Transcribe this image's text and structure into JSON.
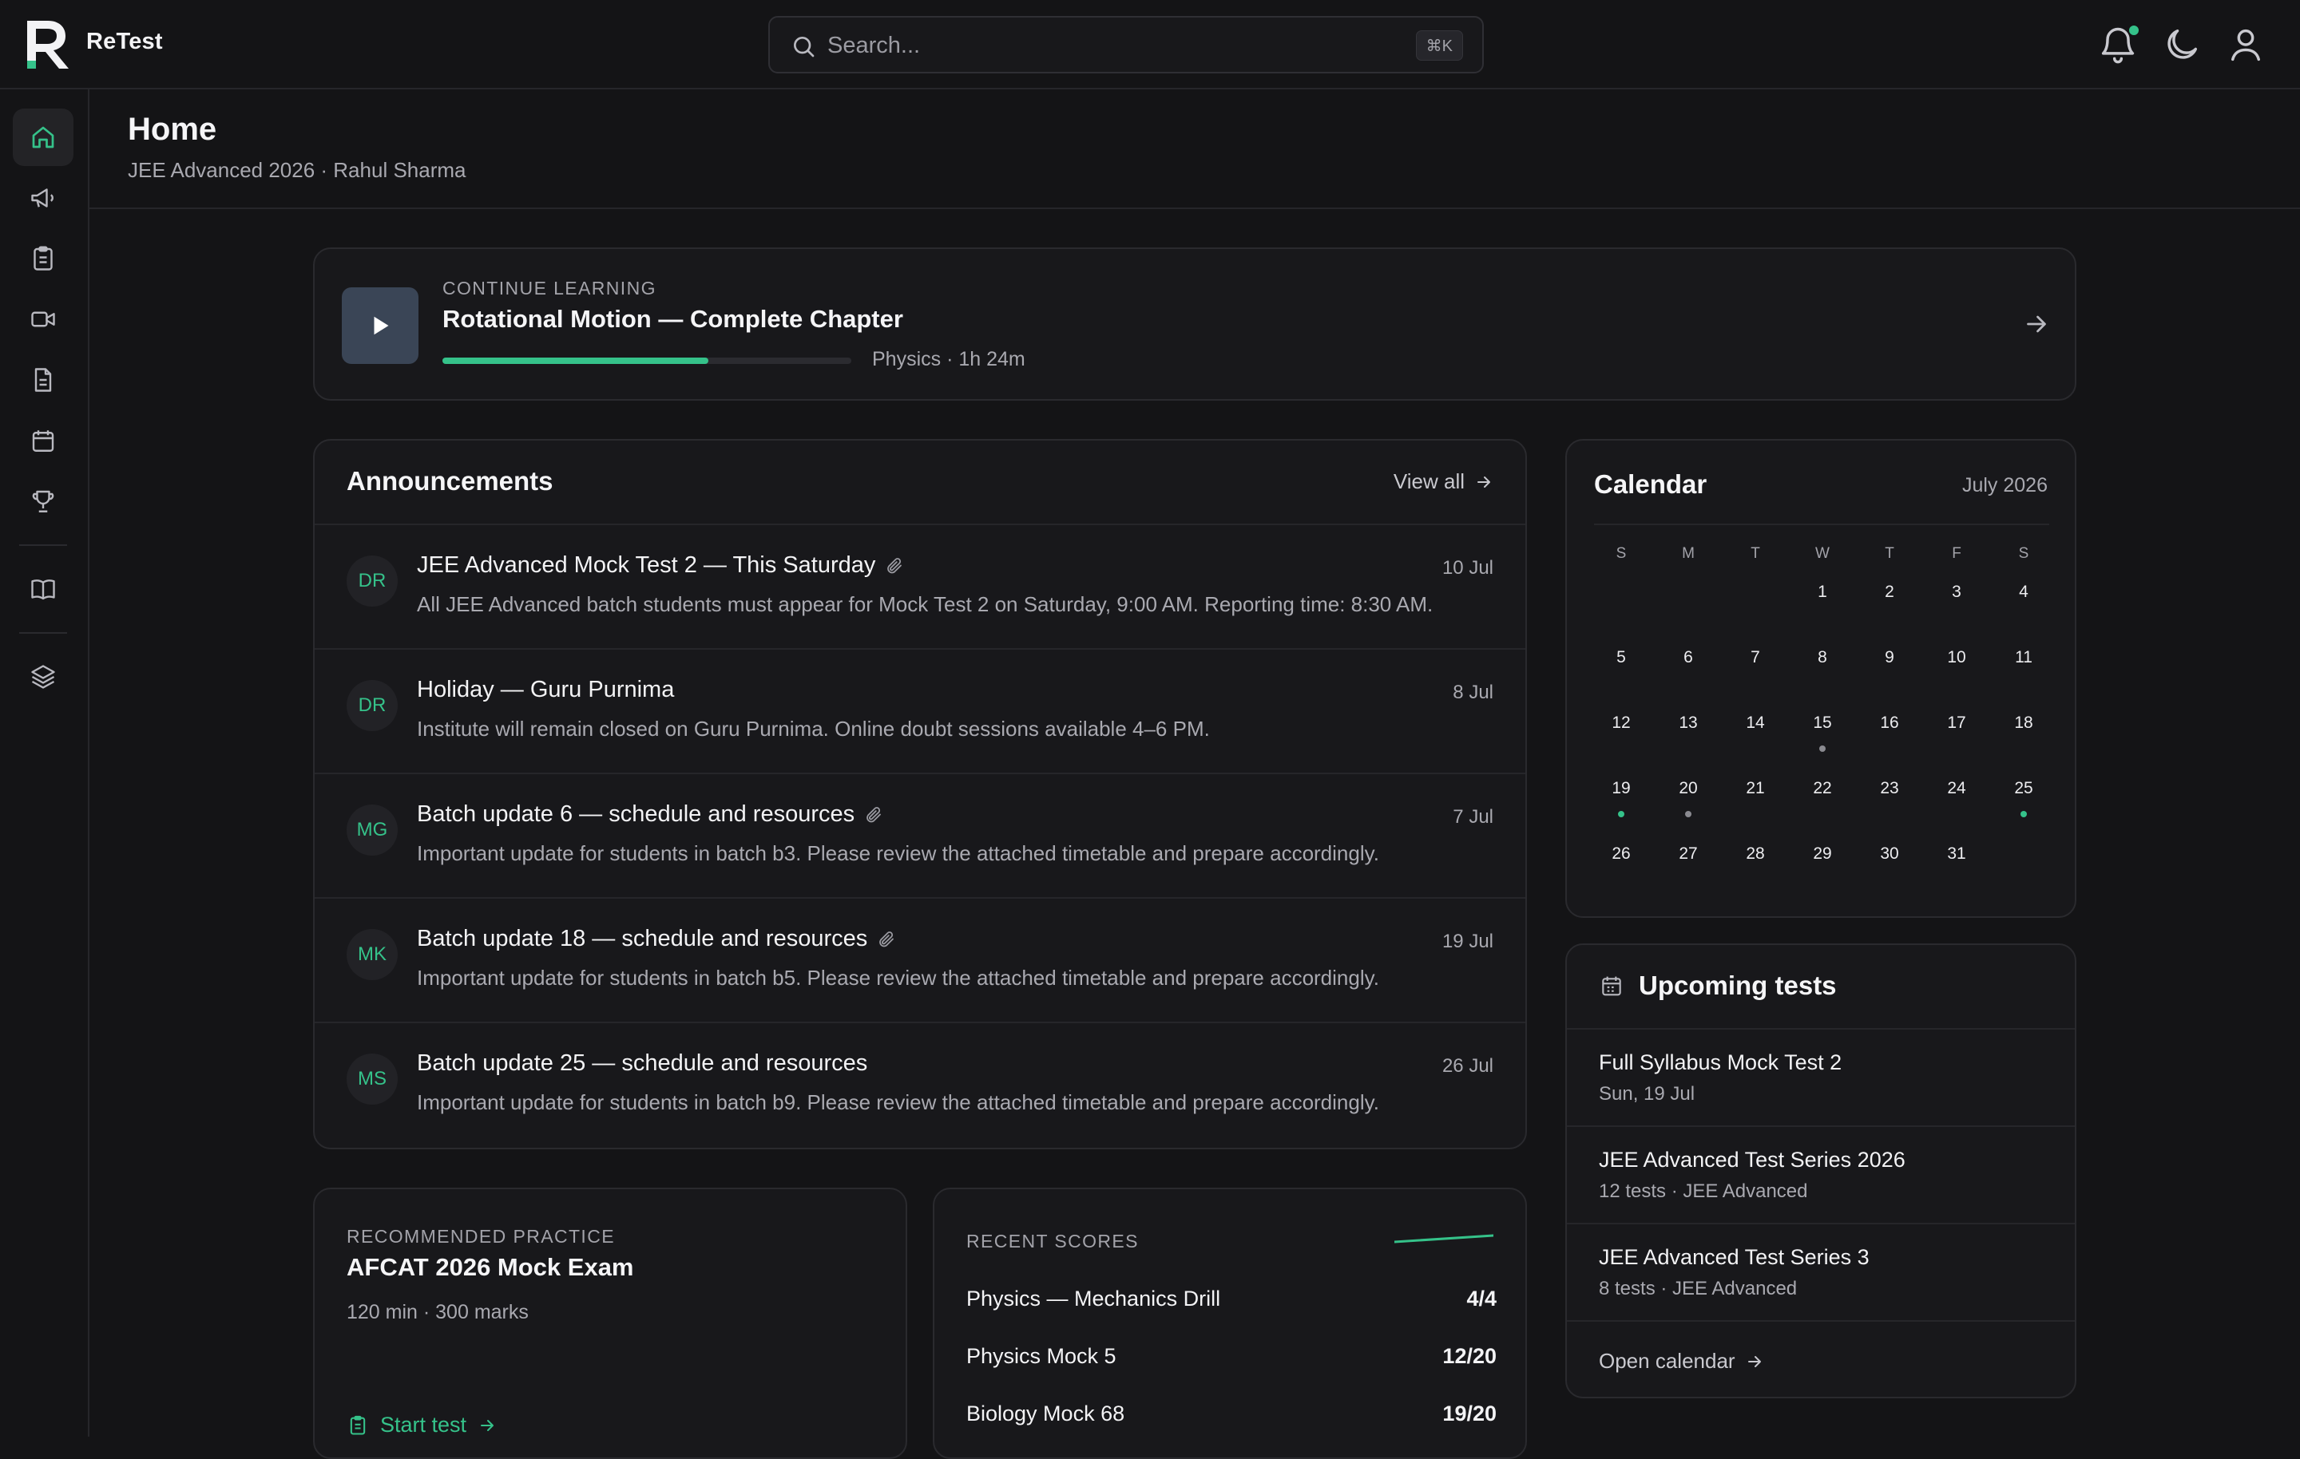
{
  "app": {
    "brand": "ReTest",
    "accent_color": "#35c28a"
  },
  "search": {
    "placeholder": "Search...",
    "shortcut": "⌘K"
  },
  "topbar_icons": [
    "bell-icon",
    "moon-icon",
    "user-icon"
  ],
  "sidebar": {
    "items": [
      {
        "name": "home",
        "icon": "home-icon",
        "active": true
      },
      {
        "name": "announcements",
        "icon": "megaphone-icon"
      },
      {
        "name": "tests",
        "icon": "clipboard-icon"
      },
      {
        "name": "videos",
        "icon": "video-icon"
      },
      {
        "name": "notes",
        "icon": "document-icon"
      },
      {
        "name": "calendar",
        "icon": "calendar-icon"
      },
      {
        "name": "leaderboard",
        "icon": "trophy-icon"
      },
      {
        "name": "library",
        "icon": "book-icon"
      },
      {
        "name": "resources",
        "icon": "layers-icon"
      }
    ]
  },
  "page": {
    "title": "Home",
    "subtitle": "JEE Advanced 2026 · Rahul Sharma"
  },
  "continue_learning": {
    "eyebrow": "CONTINUE LEARNING",
    "title": "Rotational Motion — Complete Chapter",
    "progress_pct": 65,
    "meta": "Physics · 1h 24m"
  },
  "announcements": {
    "title": "Announcements",
    "view_all": "View all",
    "items": [
      {
        "initials": "DR",
        "title": "JEE Advanced Mock Test 2 — This Saturday",
        "attachment": true,
        "date": "10 Jul",
        "body": "All JEE Advanced batch students must appear for Mock Test 2 on Saturday, 9:00 AM. Reporting time: 8:30 AM."
      },
      {
        "initials": "DR",
        "title": "Holiday — Guru Purnima",
        "attachment": false,
        "date": "8 Jul",
        "body": "Institute will remain closed on Guru Purnima. Online doubt sessions available 4–6 PM."
      },
      {
        "initials": "MG",
        "title": "Batch update 6 — schedule and resources",
        "attachment": true,
        "date": "7 Jul",
        "body": "Important update for students in batch b3. Please review the attached timetable and prepare accordingly."
      },
      {
        "initials": "MK",
        "title": "Batch update 18 — schedule and resources",
        "attachment": true,
        "date": "19 Jul",
        "body": "Important update for students in batch b5. Please review the attached timetable and prepare accordingly."
      },
      {
        "initials": "MS",
        "title": "Batch update 25 — schedule and resources",
        "attachment": false,
        "date": "26 Jul",
        "body": "Important update for students in batch b9. Please review the attached timetable and prepare accordingly."
      }
    ]
  },
  "calendar": {
    "title": "Calendar",
    "month": "July 2026",
    "weekdays": [
      "S",
      "M",
      "T",
      "W",
      "T",
      "F",
      "S"
    ],
    "weeks": [
      [
        "",
        "",
        "",
        "1",
        "2",
        "3",
        "4"
      ],
      [
        "5",
        "6",
        "7",
        "8",
        "9",
        "10",
        "11"
      ],
      [
        "12",
        "13",
        "14",
        "15",
        "16",
        "17",
        "18"
      ],
      [
        "19",
        "20",
        "21",
        "22",
        "23",
        "24",
        "25"
      ],
      [
        "26",
        "27",
        "28",
        "29",
        "30",
        "31",
        ""
      ]
    ],
    "marked_days": {
      "15": "#8a8a90",
      "19": "#35c28a",
      "20": "#8a8a90",
      "25": "#35c28a"
    }
  },
  "upcoming_tests": {
    "title": "Upcoming tests",
    "items": [
      {
        "name": "Full Syllabus Mock Test 2",
        "meta": "Sun, 19 Jul"
      },
      {
        "name": "JEE Advanced Test Series 2026",
        "meta": "12 tests · JEE Advanced"
      },
      {
        "name": "JEE Advanced Test Series 3",
        "meta": "8 tests · JEE Advanced"
      }
    ],
    "footer": "Open calendar"
  },
  "recommended": {
    "eyebrow": "RECOMMENDED PRACTICE",
    "title": "AFCAT 2026 Mock Exam",
    "meta": "120 min · 300 marks",
    "cta": "Start test"
  },
  "recent_scores": {
    "eyebrow": "RECENT SCORES",
    "items": [
      {
        "name": "Physics — Mechanics Drill",
        "score": "4/4"
      },
      {
        "name": "Physics Mock 5",
        "score": "12/20"
      },
      {
        "name": "Biology Mock 68",
        "score": "19/20"
      }
    ]
  }
}
